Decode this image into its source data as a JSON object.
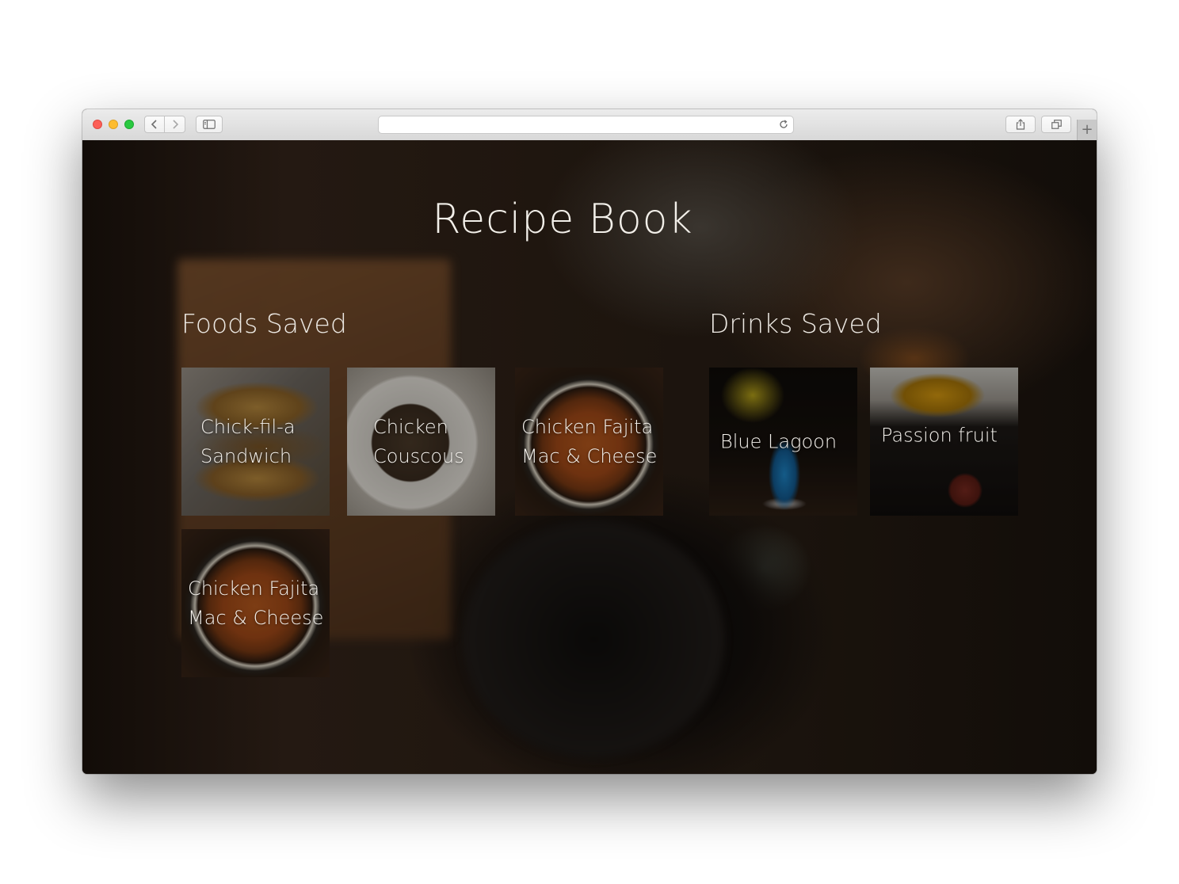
{
  "browser": {
    "address_text": "",
    "new_tab_symbol": "+"
  },
  "page": {
    "title": "Recipe Book"
  },
  "foods": {
    "heading": "Foods Saved",
    "items": [
      {
        "label": "Chick-fil-a Sandwich"
      },
      {
        "label": "Chicken Couscous"
      },
      {
        "label": "Chicken Fajita Mac & Cheese"
      },
      {
        "label": "Chicken Fajita Mac & Cheese"
      }
    ]
  },
  "drinks": {
    "heading": "Drinks Saved",
    "items": [
      {
        "label": "Blue Lagoon"
      },
      {
        "label": "Passion fruit"
      }
    ]
  }
}
